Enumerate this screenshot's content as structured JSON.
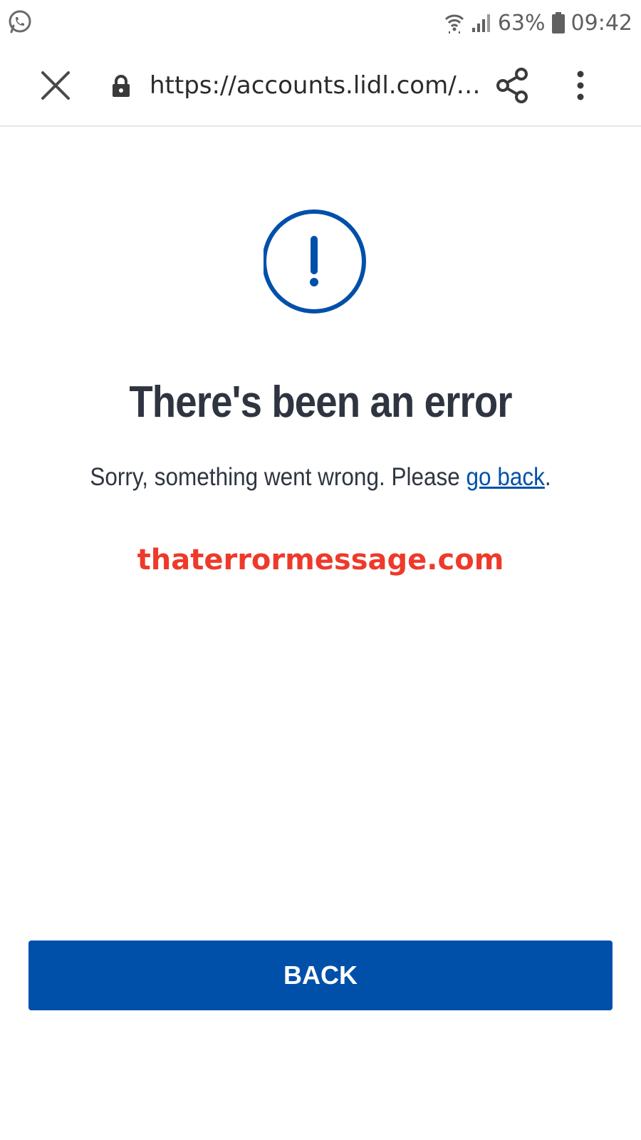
{
  "status_bar": {
    "left_icon": "whatsapp-icon",
    "right_icons": [
      "wifi-icon",
      "signal-icon",
      "battery-icon"
    ],
    "battery": "63%",
    "time": "09:42"
  },
  "toolbar": {
    "close_icon": "close-icon",
    "lock_icon": "lock-icon",
    "url": "https://accounts.lidl.com/…",
    "share_icon": "share-icon",
    "menu_icon": "more-vert-icon"
  },
  "content": {
    "icon": "exclamation-circle-icon",
    "title": "There's been an error",
    "message_prefix": "Sorry, something went wrong. Please ",
    "message_link": "go back",
    "message_suffix": ".",
    "watermark": "thaterrormessage.com",
    "back_button": "BACK"
  },
  "colors": {
    "brand_blue": "#0050aa",
    "text_dark": "#2f3540",
    "watermark_red": "#ee3a2b",
    "status_gray": "#606060"
  }
}
